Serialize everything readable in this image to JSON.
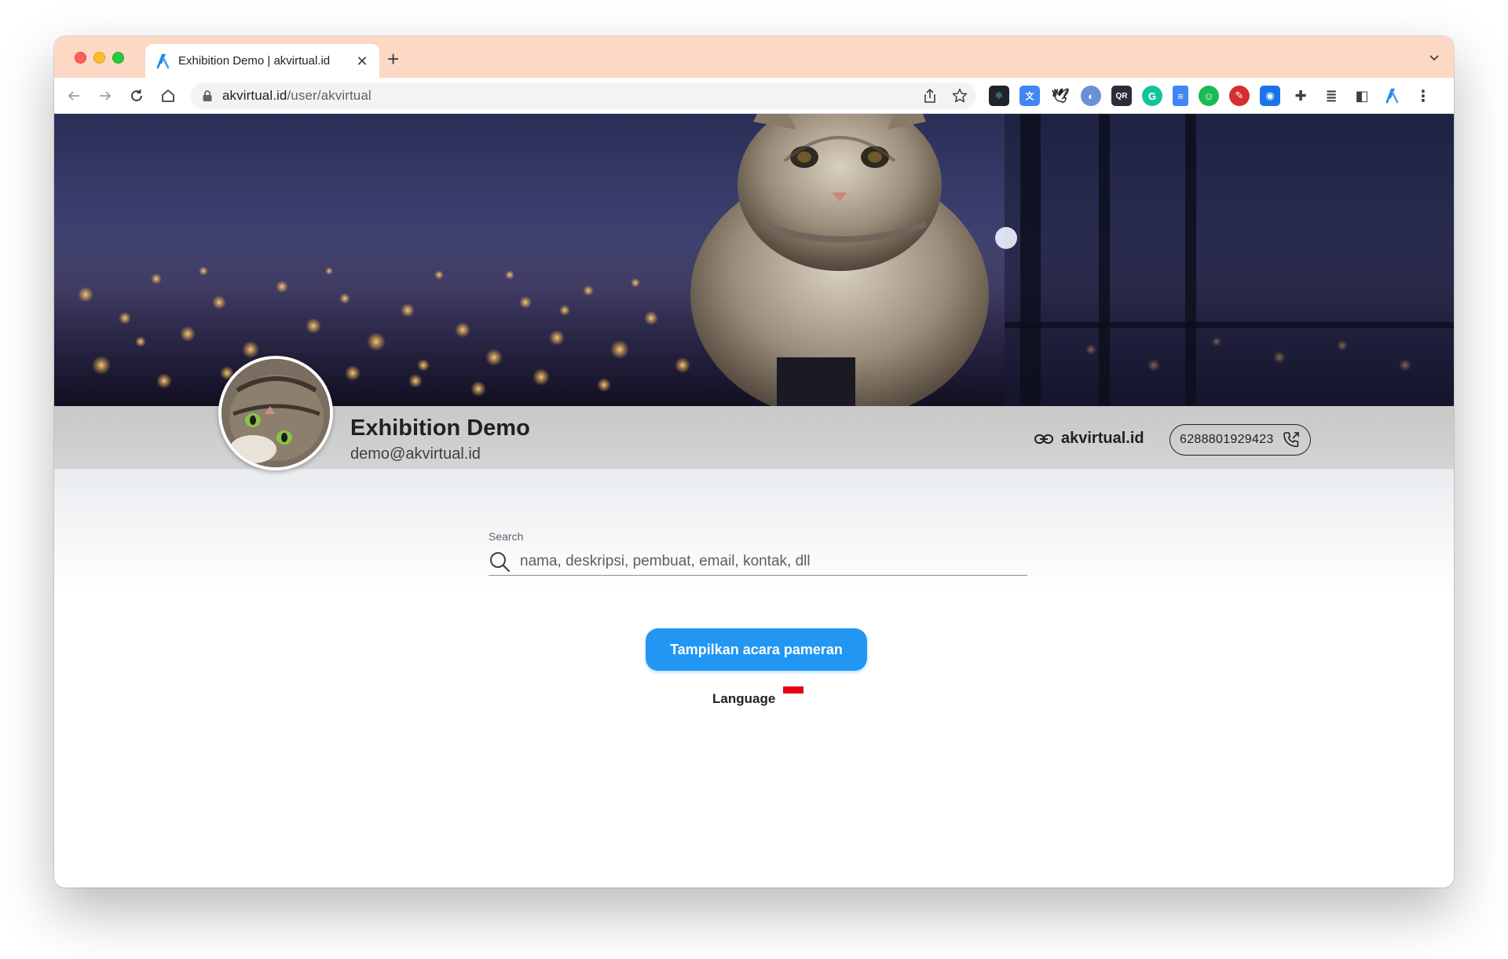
{
  "browser": {
    "tab_title": "Exhibition Demo | akvirtual.id",
    "url_host": "akvirtual.id",
    "url_path": "/user/akvirtual",
    "extensions": [
      "react-devtools-icon",
      "translate-icon",
      "bird-icon",
      "ext-circle-icon",
      "qr-code-icon",
      "grammarly-icon",
      "docs-icon",
      "green-circle-icon",
      "red-ext-icon",
      "camera-icon",
      "puzzle-icon",
      "reading-list-icon",
      "sidebar-icon",
      "akvirtual-icon",
      "more-icon"
    ]
  },
  "profile": {
    "name": "Exhibition Demo",
    "email": "demo@akvirtual.id",
    "website": "akvirtual.id",
    "phone": "6288801929423"
  },
  "search": {
    "label": "Search",
    "placeholder": "nama, deskripsi, pembuat, email, kontak, dll"
  },
  "actions": {
    "show_events": "Tampilkan acara pameran"
  },
  "language": {
    "label": "Language",
    "flag": "indonesia-flag-icon"
  },
  "colors": {
    "accent": "#2196f3",
    "tabstrip": "#fdd8c5"
  }
}
